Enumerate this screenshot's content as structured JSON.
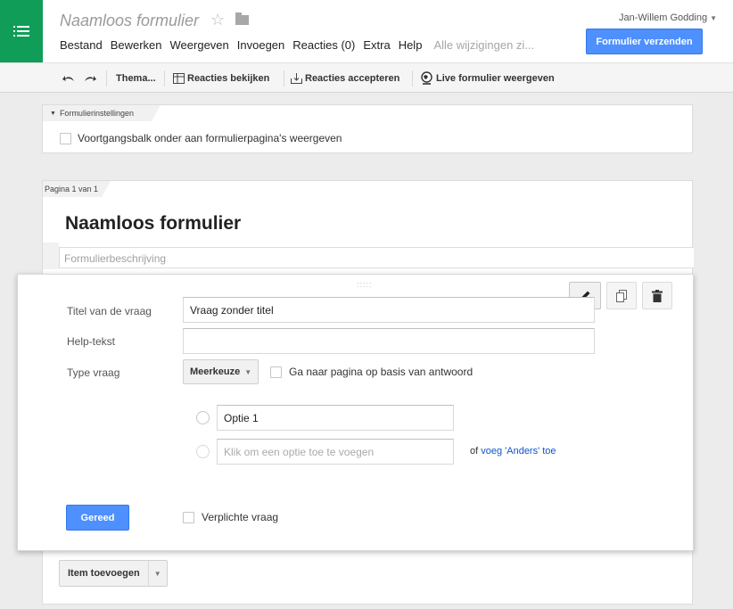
{
  "header": {
    "doc_title": "Naamloos formulier",
    "star_glyph": "☆",
    "user_name": "Jan-Willem Godding",
    "user_caret": "▼",
    "send_button": "Formulier verzenden",
    "save_status": "Alle wijzigingen zi...",
    "menu": [
      "Bestand",
      "Bewerken",
      "Weergeven",
      "Invoegen",
      "Reacties (0)",
      "Extra",
      "Help"
    ],
    "accent_color": "#4d90fe",
    "app_color": "#0f9d58"
  },
  "toolbar": {
    "theme": "Thema...",
    "view_responses": "Reacties bekijken",
    "accept_responses": "Reacties accepteren",
    "live_form": "Live formulier weergeven"
  },
  "settings": {
    "tab_label": "Formulierinstellingen",
    "progress_bar_label": "Voortgangsbalk onder aan formulierpagina's weergeven"
  },
  "page": {
    "tab_label": "Pagina 1 van 1",
    "form_title": "Naamloos formulier",
    "description_placeholder": "Formulierbeschrijving"
  },
  "question": {
    "title_label": "Titel van de vraag",
    "title_value": "Vraag zonder titel",
    "help_label": "Help-tekst",
    "help_value": "",
    "type_label": "Type vraag",
    "type_value": "Meerkeuze",
    "page_branch_label": "Ga naar pagina op basis van antwoord",
    "option_1": "Optie 1",
    "add_option_placeholder": "Klik om een optie toe te voegen",
    "add_other_prefix": "of ",
    "add_other_link": "voeg 'Anders' toe",
    "done_button": "Gereed",
    "required_label": "Verplichte vraag",
    "drag_glyph": ":::::"
  },
  "add_item": {
    "label": "Item toevoegen"
  }
}
